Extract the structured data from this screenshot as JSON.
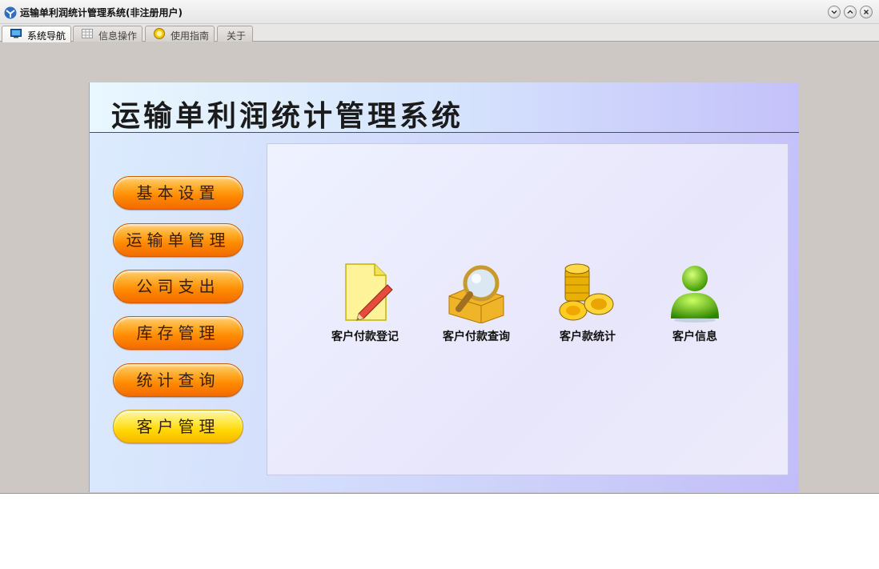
{
  "window": {
    "title": "运输单利润统计管理系统(非注册用户)",
    "controls": [
      "minimize",
      "maximize",
      "close"
    ]
  },
  "tabs": [
    {
      "label": "系统导航",
      "icon": "monitor-icon",
      "active": true
    },
    {
      "label": "信息操作",
      "icon": "grid-icon",
      "active": false
    },
    {
      "label": "使用指南",
      "icon": "help-icon",
      "active": false
    },
    {
      "label": "关于",
      "icon": "",
      "active": false
    }
  ],
  "panel": {
    "title": "运输单利润统计管理系统"
  },
  "sidebar": {
    "items": [
      {
        "label": "基本设置",
        "selected": false
      },
      {
        "label": "运输单管理",
        "selected": false
      },
      {
        "label": "公司支出",
        "selected": false
      },
      {
        "label": "库存管理",
        "selected": false
      },
      {
        "label": "统计查询",
        "selected": false
      },
      {
        "label": "客户管理",
        "selected": true
      }
    ]
  },
  "functions": [
    {
      "label": "客户付款登记",
      "icon": "notepad-pencil-icon"
    },
    {
      "label": "客户付款查询",
      "icon": "magnifier-icon"
    },
    {
      "label": "客户款统计",
      "icon": "coins-icon"
    },
    {
      "label": "客户信息",
      "icon": "user-icon"
    }
  ],
  "colors": {
    "button_orange": "#ff8a00",
    "button_selected_yellow": "#ffd400",
    "panel_gradient_start": "#dcecfd",
    "panel_gradient_end": "#c2bdf7"
  }
}
